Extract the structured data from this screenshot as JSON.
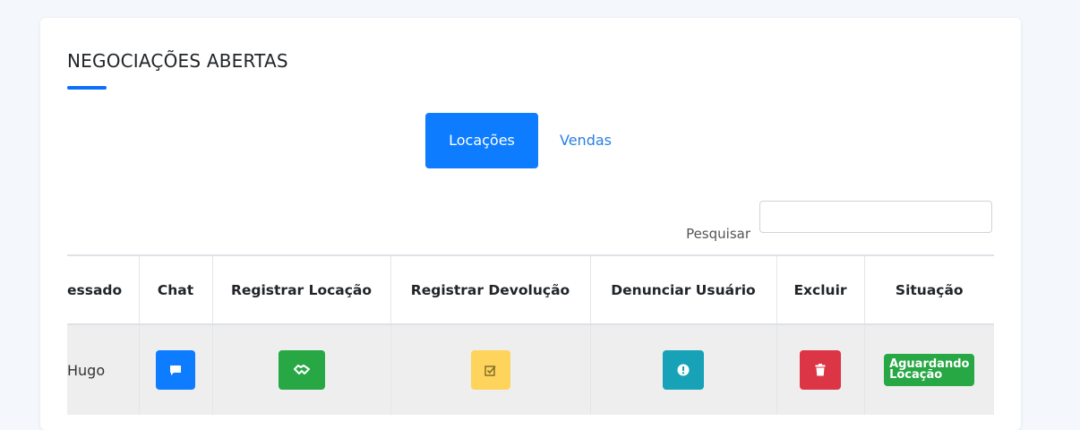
{
  "page": {
    "title": "NEGOCIAÇÕES ABERTAS"
  },
  "tabs": [
    {
      "label": "Locações",
      "active": true
    },
    {
      "label": "Vendas",
      "active": false
    }
  ],
  "search": {
    "label": "Pesquisar",
    "value": ""
  },
  "table": {
    "columns": [
      "essado",
      "Chat",
      "Registrar Locação",
      "Registrar Devolução",
      "Denunciar Usuário",
      "Excluir",
      "Situação"
    ],
    "rows": [
      {
        "interessado": "Hugo",
        "chat_icon": "chat-bubble-icon",
        "registrar_locacao_icon": "handshake-icon",
        "registrar_devolucao_icon": "checkbox-icon",
        "denunciar_icon": "exclamation-icon",
        "excluir_icon": "trash-icon",
        "situacao_line1": "Aguardando",
        "situacao_line2": "Locação"
      }
    ]
  },
  "colors": {
    "primary": "#0d7cff",
    "success": "#28a745",
    "warning": "#ffd45c",
    "info": "#17a2b8",
    "danger": "#dc3545",
    "link": "#2a7fe0"
  }
}
